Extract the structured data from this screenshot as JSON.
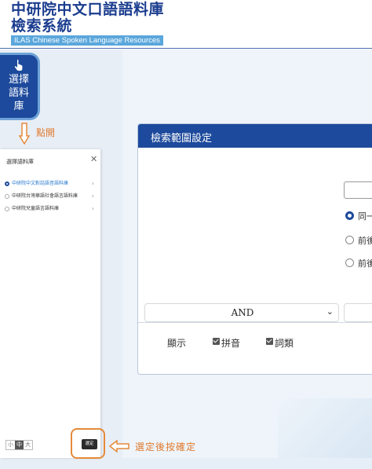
{
  "header": {
    "title_line1": "中研院中文口語語料庫",
    "title_line2": "檢索系統",
    "subtitle": "ILAS Chinese Spoken Language Resources"
  },
  "select_tab": {
    "label": "選擇語料庫",
    "icon": "pointer-hand-icon"
  },
  "annotations": {
    "click_open": "點開",
    "confirm_after_select": "選定後按確定",
    "accent_color": "#e58a3a"
  },
  "drawer": {
    "title": "選擇語料庫",
    "close_glyph": "✕",
    "options": [
      {
        "label": "中研院中文對話語音語料庫",
        "selected": true
      },
      {
        "label": "中研院台灣華語社會語言語料庫",
        "selected": false
      },
      {
        "label": "中研院兒童語言語料庫",
        "selected": false
      }
    ],
    "font_sizes": [
      "小",
      "中",
      "大"
    ],
    "font_size_selected": "中",
    "confirm_label": "選定"
  },
  "panel": {
    "title": "檢索範圍設定",
    "radio_options": [
      {
        "label": "同一",
        "selected": true
      },
      {
        "label": "前後",
        "selected": false
      },
      {
        "label": "前後",
        "selected": false
      }
    ],
    "operator": "AND",
    "display_label": "顯示",
    "checkboxes": [
      {
        "label": "拼音",
        "checked": true
      },
      {
        "label": "詞類",
        "checked": true
      }
    ]
  },
  "colors": {
    "brand_blue": "#1d4a9c",
    "subtitle_bg": "#5aa7dc",
    "selected_text": "#2a7bd0"
  }
}
